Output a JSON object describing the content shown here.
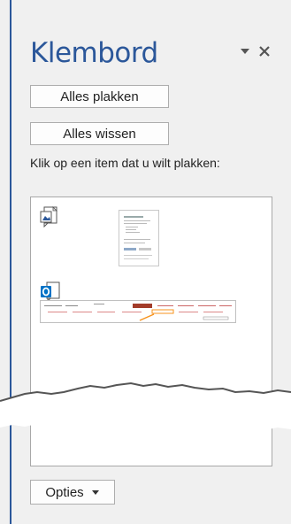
{
  "pane": {
    "title": "Klembord",
    "paste_all_label": "Alles plakken",
    "clear_all_label": "Alles wissen",
    "hint": "Klik op een item dat u wilt plakken:",
    "options_label": "Opties"
  },
  "items": [
    {
      "type_icon": "picture-clipboard-icon",
      "thumbnail": "document-page-thumbnail"
    },
    {
      "type_icon": "outlook-icon",
      "thumbnail": "webpage-screenshot-thumbnail"
    }
  ],
  "colors": {
    "accent": "#2b579a",
    "outlook": "#0072c6",
    "highlight": "#f7931e"
  }
}
